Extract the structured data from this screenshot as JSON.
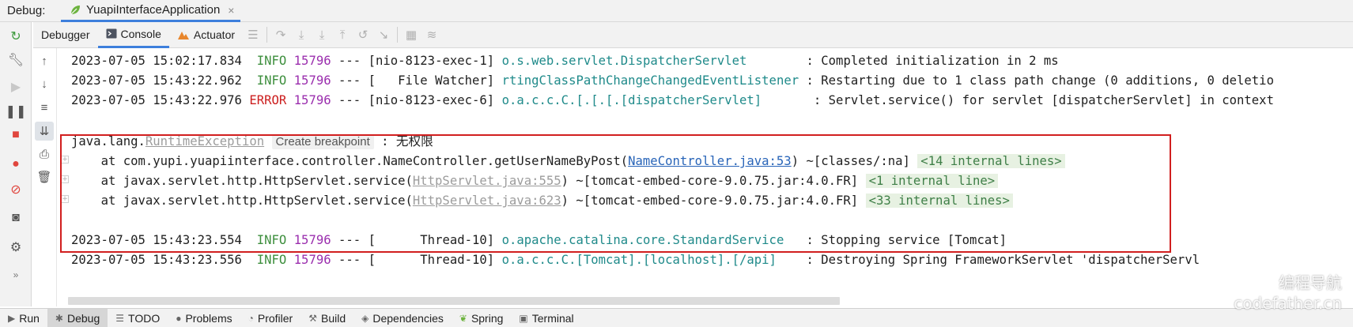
{
  "titlebar": {
    "label": "Debug:",
    "run_tab": "YuapiInterfaceApplication",
    "close_glyph": "×"
  },
  "toolbar": {
    "tabs": [
      {
        "label": "Debugger",
        "icon": ""
      },
      {
        "label": "Console",
        "icon": "console-icon"
      },
      {
        "label": "Actuator",
        "icon": "actuator-icon"
      }
    ],
    "icons": [
      "frames-layout-icon",
      "step-over-icon",
      "step-into-icon",
      "force-step-into-icon",
      "step-out-icon",
      "drop-frame-icon",
      "run-to-cursor-icon",
      "evaluate-icon",
      "trace-icon"
    ]
  },
  "left_actions": [
    "rerun-icon",
    "settings-wrench-icon",
    "resume-icon",
    "pause-icon",
    "stop-icon",
    "view-breakpoints-icon",
    "mute-breakpoints-icon",
    "camera-icon",
    "settings-gear-icon",
    "more-icon"
  ],
  "console_actions": [
    "up-arrow-icon",
    "down-arrow-icon",
    "soft-wrap-icon",
    "scroll-to-end-icon",
    "print-icon",
    "trash-icon"
  ],
  "logs": [
    {
      "timestamp": "2023-07-05 15:02:17.834",
      "level": "INFO",
      "pid": "15796",
      "sep": "---",
      "thread": "[nio-8123-exec-1]",
      "logger": "o.s.web.servlet.DispatcherServlet",
      "message": ": Completed initialization in 2 ms"
    },
    {
      "timestamp": "2023-07-05 15:43:22.962",
      "level": "INFO",
      "pid": "15796",
      "sep": "---",
      "thread": "[   File Watcher]",
      "logger": "rtingClassPathChangeChangedEventListener",
      "message": ": Restarting due to 1 class path change (0 additions, 0 deletio"
    },
    {
      "timestamp": "2023-07-05 15:43:22.976",
      "level": "ERROR",
      "pid": "15796",
      "sep": "---",
      "thread": "[nio-8123-exec-6]",
      "logger": "o.a.c.c.C.[.[.[.[dispatcherServlet]",
      "message": ": Servlet.service() for servlet [dispatcherServlet] in context "
    }
  ],
  "exception": {
    "prefix": "java.lang.",
    "class_name": "RuntimeException",
    "breakpoint_hint": "Create breakpoint",
    "colon": " : ",
    "message": "无权限",
    "frames": [
      {
        "at": "at com.yupi.yuapiinterface.controller.NameController.getUserNameByPost(",
        "source": "NameController.java:53",
        "tail": ") ~[classes/:na]",
        "internal": "<14 internal lines>"
      },
      {
        "at": "at javax.servlet.http.HttpServlet.service(",
        "source": "HttpServlet.java:555",
        "tail": ") ~[tomcat-embed-core-9.0.75.jar:4.0.FR]",
        "internal": "<1 internal line>"
      },
      {
        "at": "at javax.servlet.http.HttpServlet.service(",
        "source": "HttpServlet.java:623",
        "tail": ") ~[tomcat-embed-core-9.0.75.jar:4.0.FR]",
        "internal": "<33 internal lines>"
      }
    ]
  },
  "logs_after": [
    {
      "timestamp": "2023-07-05 15:43:23.554",
      "level": "INFO",
      "pid": "15796",
      "sep": "---",
      "thread": "[      Thread-10]",
      "logger": "o.apache.catalina.core.StandardService",
      "message": ": Stopping service [Tomcat]"
    },
    {
      "timestamp": "2023-07-05 15:43:23.556",
      "level": "INFO",
      "pid": "15796",
      "sep": "---",
      "thread": "[      Thread-10]",
      "logger": "o.a.c.c.C.[Tomcat].[localhost].[/api]",
      "message": ": Destroying Spring FrameworkServlet 'dispatcherServl"
    }
  ],
  "bottom_tabs": [
    {
      "label": "Run",
      "icon": "run-icon"
    },
    {
      "label": "Debug",
      "icon": "debug-icon"
    },
    {
      "label": "TODO",
      "icon": "todo-icon"
    },
    {
      "label": "Problems",
      "icon": "problems-icon"
    },
    {
      "label": "Profiler",
      "icon": "profiler-icon"
    },
    {
      "label": "Build",
      "icon": "build-icon"
    },
    {
      "label": "Dependencies",
      "icon": "dependencies-icon"
    },
    {
      "label": "Spring",
      "icon": "spring-icon"
    },
    {
      "label": "Terminal",
      "icon": "terminal-icon"
    }
  ],
  "watermark": {
    "line1": "编程导航",
    "line2": "codefather.cn"
  },
  "colors": {
    "accent": "#3d7fdc",
    "error_box": "#d11f1f",
    "info": "#3e8f3e",
    "error": "#cc1f1f",
    "pid": "#9b2fae",
    "logger": "#1f8a8a",
    "link": "#2864b8"
  }
}
